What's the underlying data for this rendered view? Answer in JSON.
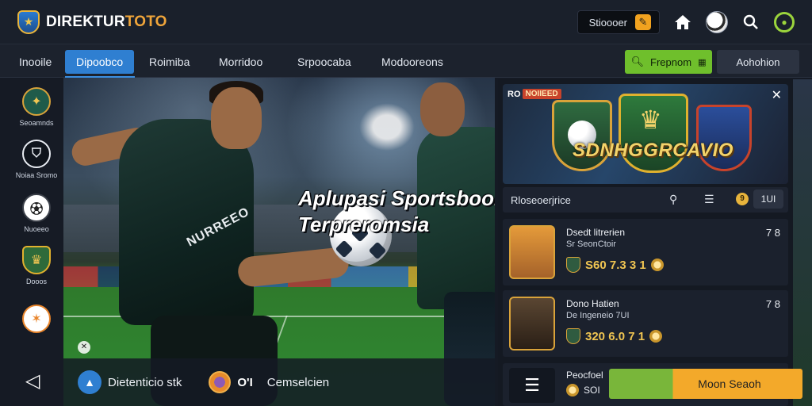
{
  "header": {
    "brand": "DIREKTUR",
    "brand_accent": "TOTO",
    "promo_label": "Stioooer",
    "icons": [
      "home-icon",
      "ball-icon",
      "search-icon",
      "profile-icon"
    ]
  },
  "nav": {
    "items": [
      "Inooile",
      "Dipoobco",
      "Roimiba",
      "Morridoo",
      "Srpoocaba",
      "Modooreons"
    ],
    "active_index": 1,
    "btn_green_label": "Frepnom",
    "btn_dark_label": "Aohohion"
  },
  "sidebar": {
    "items": [
      {
        "label": "Seoamnds"
      },
      {
        "label": "Noiaa Sromo"
      },
      {
        "label": "Nuoeeo"
      },
      {
        "label": "Dooos"
      },
      {
        "label": ""
      }
    ]
  },
  "hero": {
    "title_line1": "Aplupasi Sportsbook",
    "title_line2": "Terpreromsia",
    "jersey": "NURREEO",
    "bottom": {
      "text1": "Dietenticio stk",
      "num": "O'I",
      "text2": "Cemselcien"
    }
  },
  "banner": {
    "tag_prefix": "RO",
    "tag": "NOIIEED",
    "title": "SDNHGGRCAVIO"
  },
  "toolrow": {
    "label": "Rloseoerjrice",
    "coin": "9",
    "pill": "1UI"
  },
  "cards": [
    {
      "name": "Dsedt litrerien",
      "sub": "Sr SeonCtoir",
      "odds": "S60 7.3 3 1",
      "score": "7 8"
    },
    {
      "name": "Dono Hatien",
      "sub": "De Ingeneio 7UI",
      "odds": "320 6.0 7 1",
      "score": "7 8"
    }
  ],
  "card_bottom": {
    "line1": "Peocfoel",
    "line2": "SOI"
  },
  "cta_label": "Moon Seaoh",
  "colors": {
    "accent_blue": "#2f7fd1",
    "accent_green": "#6fbf2c",
    "accent_orange": "#f3a92a",
    "gold": "#f0c552"
  }
}
